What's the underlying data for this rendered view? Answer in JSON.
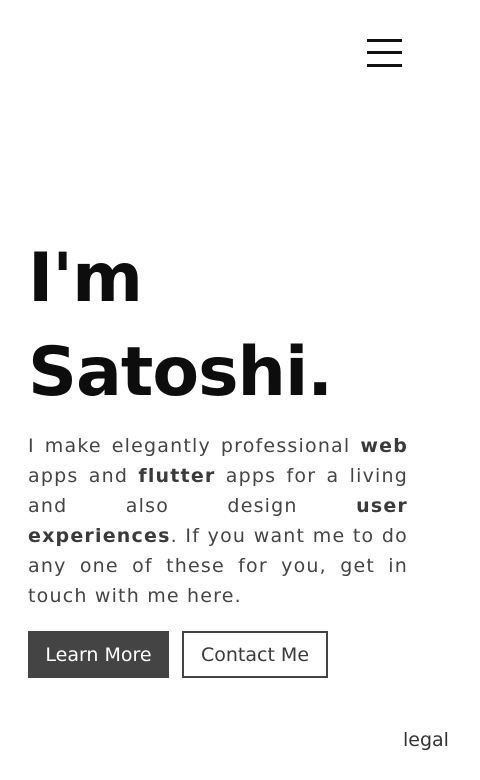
{
  "header": {
    "menu_icon": "hamburger-menu-icon"
  },
  "hero": {
    "title_line1": "I'm",
    "title_line2": "Satoshi."
  },
  "intro": {
    "part1": "I make elegantly professional ",
    "bold1": "web",
    "part2": " apps and ",
    "bold2": "flutter",
    "part3": " apps for a living and also design ",
    "bold3": "user experiences",
    "part4": ". If you want me to do any one of these for you, get in touch with me here."
  },
  "buttons": {
    "learn_more": "Learn More",
    "contact_me": "Contact Me"
  },
  "footer": {
    "legal": "legal"
  },
  "colors": {
    "primary_button": "#444444",
    "text": "#444444",
    "heading": "#0d0d0d"
  }
}
